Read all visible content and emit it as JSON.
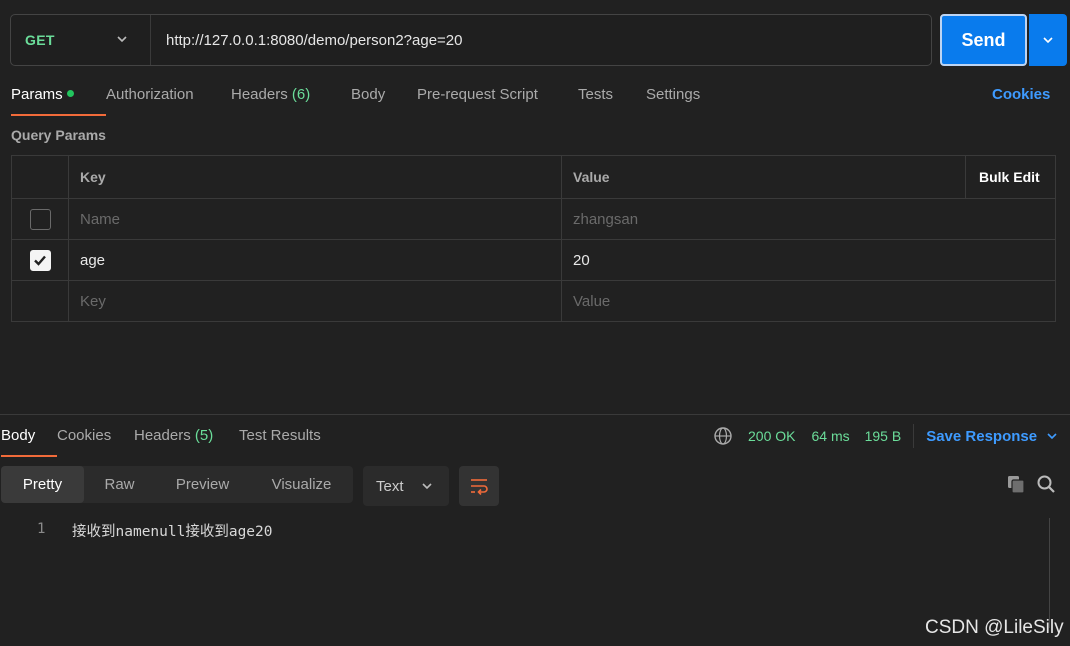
{
  "request": {
    "method": "GET",
    "url": "http://127.0.0.1:8080/demo/person2?age=20",
    "send_label": "Send"
  },
  "req_tabs": {
    "params": "Params",
    "authorization": "Authorization",
    "headers": "Headers",
    "headers_count": "(6)",
    "body": "Body",
    "pre_request": "Pre-request Script",
    "tests": "Tests",
    "settings": "Settings",
    "cookies": "Cookies"
  },
  "query_params": {
    "title": "Query Params",
    "headers": {
      "key": "Key",
      "value": "Value",
      "bulk_edit": "Bulk Edit"
    },
    "rows": [
      {
        "key": "Name",
        "value": "zhangsan",
        "checked": false,
        "placeholder": true
      },
      {
        "key": "age",
        "value": "20",
        "checked": true,
        "placeholder": false
      }
    ],
    "new_row": {
      "key": "Key",
      "value": "Value"
    }
  },
  "response": {
    "tabs": {
      "body": "Body",
      "cookies": "Cookies",
      "headers": "Headers",
      "headers_count": "(5)",
      "test_results": "Test Results"
    },
    "status": "200 OK",
    "time": "64 ms",
    "size": "195 B",
    "save_response": "Save Response",
    "views": [
      "Pretty",
      "Raw",
      "Preview",
      "Visualize"
    ],
    "format": "Text",
    "lines": [
      {
        "no": "1",
        "text": "接收到namenull接收到age20"
      }
    ]
  },
  "colors": {
    "accent_blue": "#097bed",
    "link_blue": "#3e9bff",
    "method_green": "#6bdd9a",
    "tab_underline": "#f26b3a"
  },
  "watermark": "CSDN @LileSily"
}
